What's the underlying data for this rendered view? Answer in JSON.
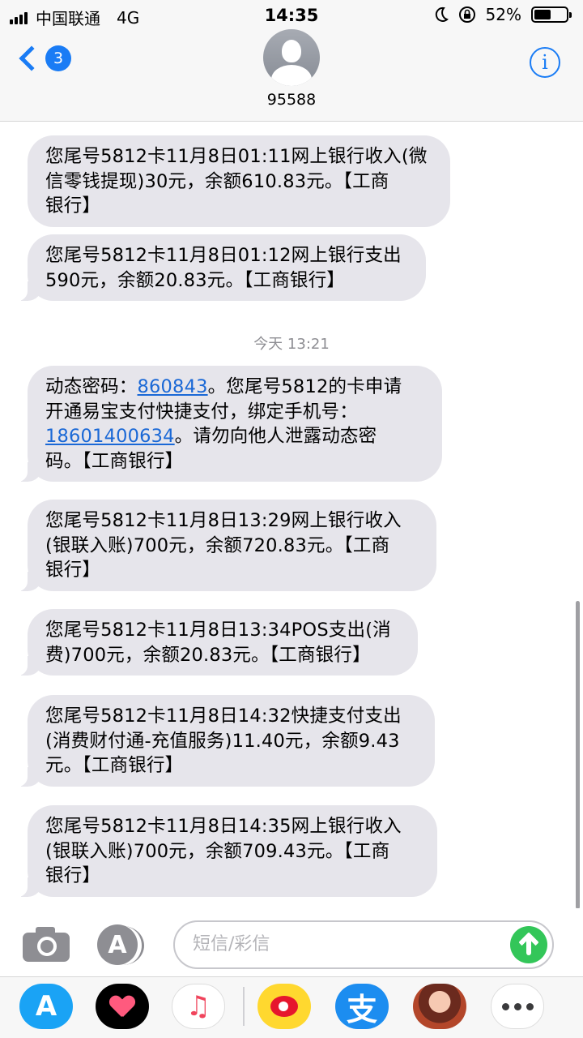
{
  "status_bar": {
    "carrier": "中国联通",
    "network": "4G",
    "time": "14:35",
    "battery_percent": "52%",
    "battery_level": 0.52
  },
  "header": {
    "back_badge": "3",
    "contact_name": "95588",
    "info_label": "i"
  },
  "conversation": {
    "timestamp": "今天 13:21",
    "messages": [
      {
        "text": "您尾号5812卡11月8日01:11网上银行收入(微\n信零钱提现)30元，余额610.83元。【工商\n银行】"
      },
      {
        "text": "您尾号5812卡11月8日01:12网上银行支出\n590元，余额20.83元。【工商银行】"
      },
      {
        "part1": "动态密码：",
        "link1": "860843",
        "part2": "。您尾号5812的卡申请\n开通易宝支付快捷支付，绑定手机号：\n",
        "link2": "18601400634",
        "part3": "。请勿向他人泄露动态密\n码。【工商银行】"
      },
      {
        "text": "您尾号5812卡11月8日13:29网上银行收入\n(银联入账)700元，余额720.83元。【工商\n银行】"
      },
      {
        "text": "您尾号5812卡11月8日13:34POS支出(消\n费)700元，余额20.83元。【工商银行】"
      },
      {
        "text": "您尾号5812卡11月8日14:32快捷支付支出\n(消费财付通-充值服务)11.40元，余额9.43\n元。【工商银行】"
      },
      {
        "text": "您尾号5812卡11月8日14:35网上银行收入\n(银联入账)700元，余额709.43元。【工商\n银行】"
      }
    ]
  },
  "input_bar": {
    "placeholder": "短信/彩信"
  },
  "app_drawer": {
    "apps": [
      "app-store-icon",
      "heart-icon",
      "music-icon",
      "weibo-icon",
      "alipay-icon",
      "game-icon",
      "more-icon"
    ],
    "appstore_glyph": "A",
    "music_glyph": "♫",
    "alipay_glyph": "支"
  },
  "colors": {
    "accent": "#1a7cf5",
    "bubble": "#e6e5eb",
    "send": "#33c659",
    "link": "#1a68d6"
  }
}
